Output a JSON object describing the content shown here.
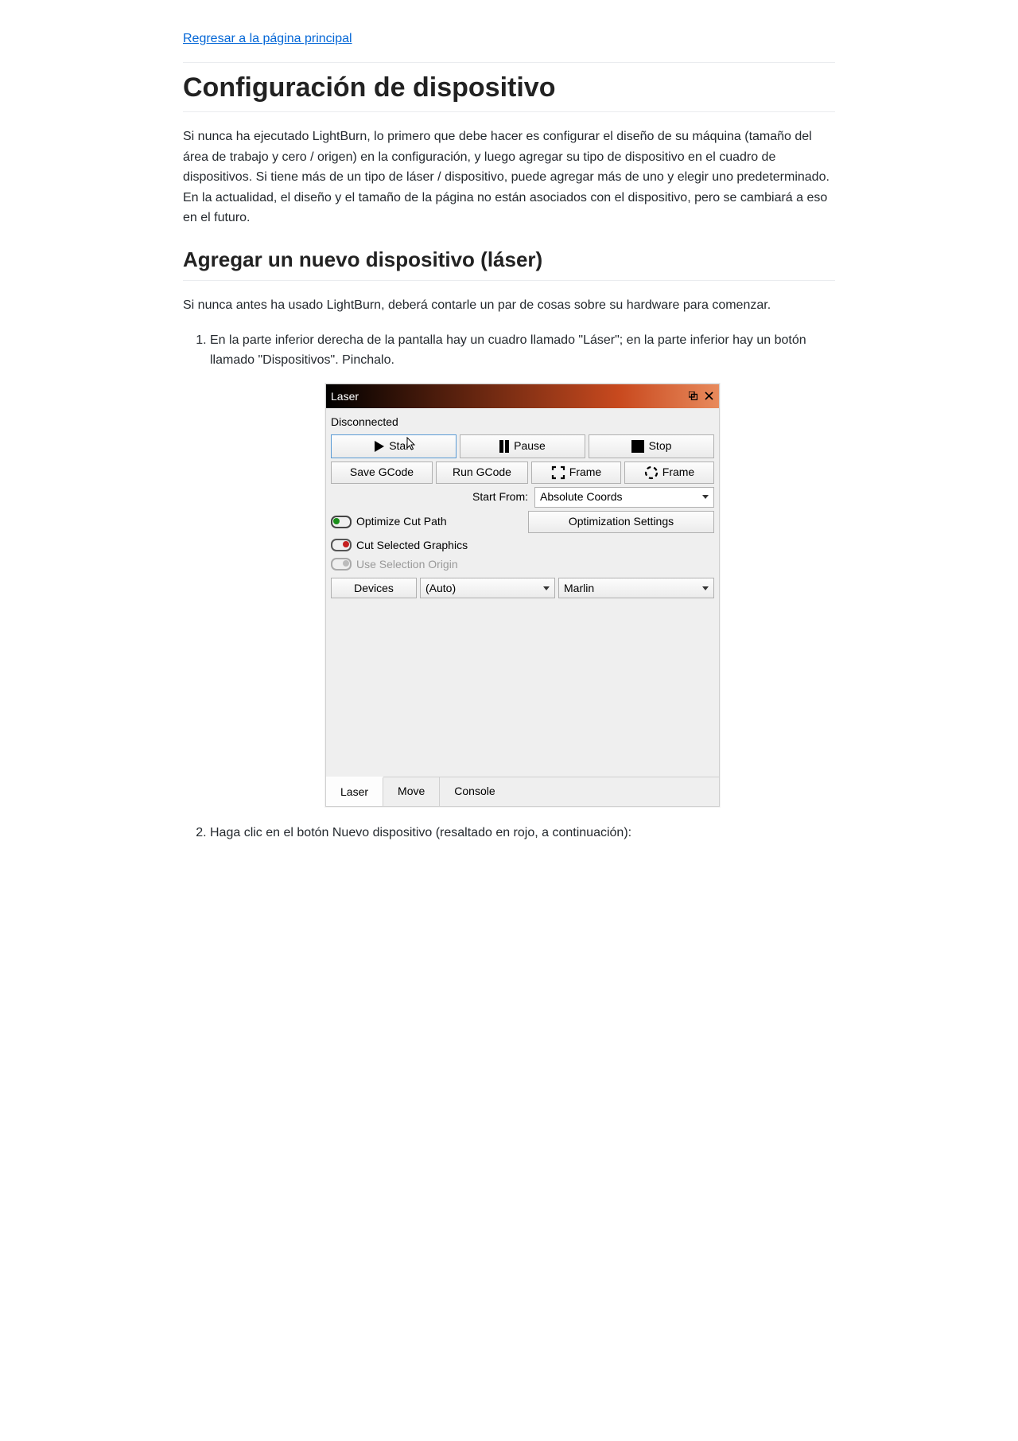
{
  "nav": {
    "back_link": "Regresar a la página principal"
  },
  "headings": {
    "h1": "Configuración de dispositivo",
    "h2": "Agregar un nuevo dispositivo (láser)"
  },
  "paragraphs": {
    "intro": "Si nunca ha ejecutado LightBurn, lo primero que debe hacer es configurar el diseño de su máquina (tamaño del área de trabajo y cero / origen) en la configuración, y luego agregar su tipo de dispositivo en el cuadro de dispositivos. Si tiene más de un tipo de láser / dispositivo, puede agregar más de uno y elegir uno predeterminado. En la actualidad, el diseño y el tamaño de la página no están asociados con el dispositivo, pero se cambiará a eso en el futuro.",
    "subintro": "Si nunca antes ha usado LightBurn, deberá contarle un par de cosas sobre su hardware para comenzar."
  },
  "list": {
    "item1": "En la parte inferior derecha de la pantalla hay un cuadro llamado \"Láser\"; en la parte inferior hay un botón llamado \"Dispositivos\". Pinchalo.",
    "item2": "Haga clic en el botón Nuevo dispositivo (resaltado en rojo, a continuación):"
  },
  "laser_panel": {
    "title": "Laser",
    "status": "Disconnected",
    "buttons": {
      "start": "Start",
      "pause": "Pause",
      "stop": "Stop",
      "save_gcode": "Save GCode",
      "run_gcode": "Run GCode",
      "frame1": "Frame",
      "frame2": "Frame"
    },
    "start_from_label": "Start From:",
    "start_from_value": "Absolute Coords",
    "optimize_cut_path": "Optimize Cut Path",
    "optimization_settings": "Optimization Settings",
    "cut_selected": "Cut Selected Graphics",
    "use_selection_origin": "Use Selection Origin",
    "devices_btn": "Devices",
    "port_value": "(Auto)",
    "device_value": "Marlin",
    "tabs": {
      "laser": "Laser",
      "move": "Move",
      "console": "Console"
    }
  }
}
